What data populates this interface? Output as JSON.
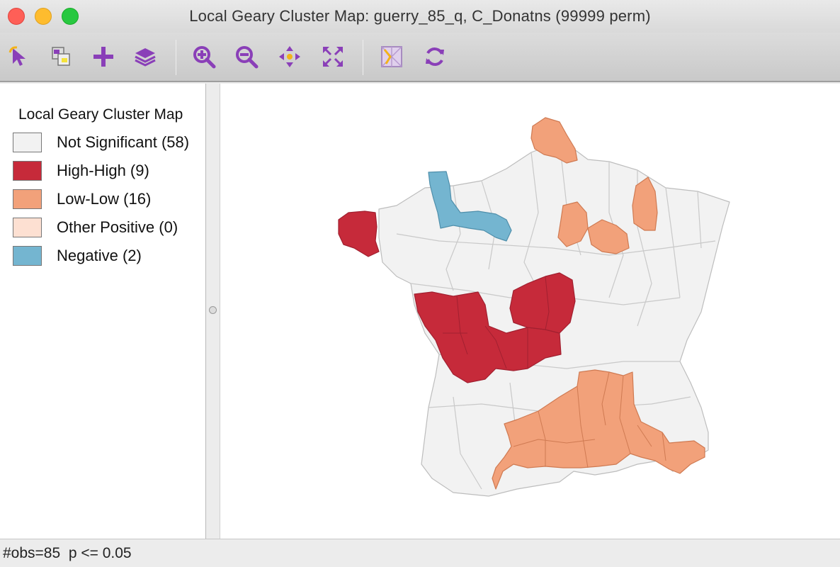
{
  "window": {
    "title": "Local Geary Cluster Map: guerry_85_q, C_Donatns (99999 perm)"
  },
  "toolbar": {
    "tools": [
      {
        "name": "select-tool",
        "icon": "arrow-pointer-icon"
      },
      {
        "name": "map-copy-tool",
        "icon": "copy-map-icon"
      },
      {
        "name": "add-layer-tool",
        "icon": "plus-icon"
      },
      {
        "name": "layers-tool",
        "icon": "layers-icon"
      },
      {
        "name": "zoom-in-tool",
        "icon": "zoom-in-icon"
      },
      {
        "name": "zoom-out-tool",
        "icon": "zoom-out-icon"
      },
      {
        "name": "pan-tool",
        "icon": "pan-arrows-icon"
      },
      {
        "name": "full-extent-tool",
        "icon": "full-extent-icon"
      },
      {
        "name": "basemap-tool",
        "icon": "basemap-icon"
      },
      {
        "name": "refresh-tool",
        "icon": "refresh-icon"
      }
    ],
    "icon_color": "#8a3fb8"
  },
  "legend": {
    "title": "Local Geary Cluster Map",
    "items": [
      {
        "label": "Not Significant (58)",
        "color": "#f2f2f2"
      },
      {
        "label": "High-High (9)",
        "color": "#c62a3a"
      },
      {
        "label": "Low-Low (16)",
        "color": "#f2a17a"
      },
      {
        "label": "Other Positive (0)",
        "color": "#fde0d2"
      },
      {
        "label": "Negative (2)",
        "color": "#74b5d0"
      }
    ]
  },
  "map": {
    "region_colors": {
      "not_significant": "#f2f2f2",
      "high_high": "#c62a3a",
      "low_low": "#f2a17a",
      "negative": "#74b5d0"
    },
    "border_color": "#bdbdbd"
  },
  "status": {
    "text": "#obs=85  p <= 0.05"
  }
}
